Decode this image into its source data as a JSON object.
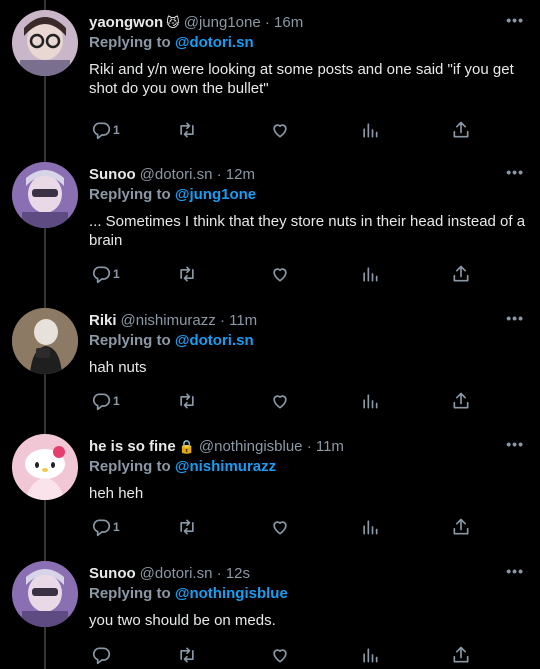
{
  "tweets": [
    {
      "name": "yaongwon",
      "emoji": "😼",
      "handle": "@jung1one",
      "time": "· 16m",
      "replying_prefix": "Replying to",
      "replying_to": "@dotori.sn",
      "text": "Riki and y/n were looking at some posts and one said \"if you get shot do you own the bullet\"",
      "reply_count": "1",
      "more": "•••",
      "avatar_color": "#c9b6c9"
    },
    {
      "name": "Sunoo",
      "emoji": "",
      "handle": "@dotori.sn",
      "time": "· 12m",
      "replying_prefix": "Replying to",
      "replying_to": "@jung1one",
      "text": "... Sometimes I think that they store nuts in their head instead of a brain",
      "reply_count": "1",
      "more": "•••",
      "avatar_color": "#8a6fb3"
    },
    {
      "name": "Riki",
      "emoji": "",
      "handle": "@nishimurazz",
      "time": "· 11m",
      "replying_prefix": "Replying to",
      "replying_to": "@dotori.sn",
      "text": "hah nuts",
      "reply_count": "1",
      "more": "•••",
      "avatar_color": "#6b5a48"
    },
    {
      "name": "he is so fine",
      "emoji": "🔒",
      "handle": "@nothingisblue",
      "time": "· 11m",
      "replying_prefix": "Replying to",
      "replying_to": "@nishimurazz",
      "text": "heh heh",
      "reply_count": "1",
      "more": "•••",
      "avatar_color": "#f1c7d5"
    },
    {
      "name": "Sunoo",
      "emoji": "",
      "handle": "@dotori.sn",
      "time": "· 12s",
      "replying_prefix": "Replying to",
      "replying_to": "@nothingisblue",
      "text": "you two should be on meds.",
      "reply_count": "",
      "more": "•••",
      "avatar_color": "#8a6fb3"
    }
  ],
  "icons": {
    "reply": "reply-icon",
    "retweet": "retweet-icon",
    "like": "heart-icon",
    "views": "views-icon",
    "share": "share-icon"
  },
  "colors": {
    "background": "#000000",
    "text": "#e7e9ea",
    "muted": "#8b98a5",
    "accent": "#1d9bf0"
  }
}
